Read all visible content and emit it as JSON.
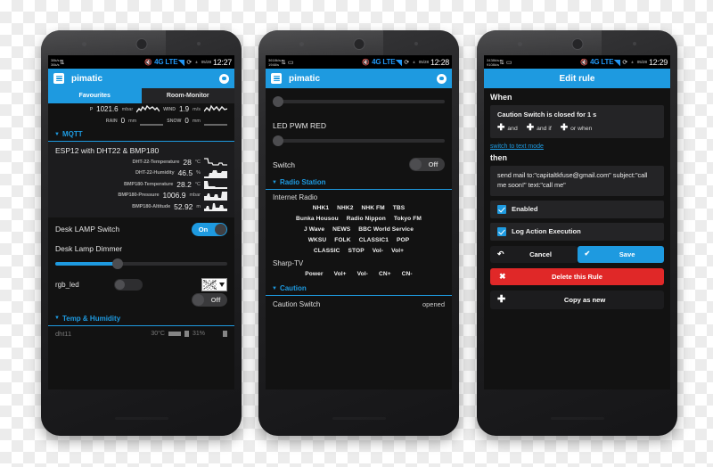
{
  "phones": [
    {
      "id": "phone-1",
      "statusbar": {
        "rate_up": "38k/s",
        "rate_down": "36k/s",
        "mute_icon": "volume-mute-icon",
        "network": "4G LTE",
        "sync_icon": "sync-icon",
        "alarm": "±",
        "date": "05/28",
        "time": "12:27"
      },
      "appbar": {
        "menu_icon": "hamburger-menu-icon",
        "title": "pimatic",
        "settings_icon": "gear-icon"
      },
      "tabs": [
        {
          "label": "Favourites",
          "active": true
        },
        {
          "label": "Room-Monitor",
          "active": false
        }
      ],
      "weather": [
        {
          "label": "P",
          "value": "1021.6",
          "unit": "mbar",
          "spark": true
        },
        {
          "label": "WIND",
          "value": "1.9",
          "unit": "m/s",
          "spark": true
        },
        {
          "label": "RAIN",
          "value": "0",
          "unit": "mm",
          "spark": true
        },
        {
          "label": "SNOW",
          "value": "0",
          "unit": "mm",
          "spark": true
        }
      ],
      "section": {
        "caret": "caret-down-icon",
        "title": "MQTT"
      },
      "card_title": "ESP12 with DHT22 & BMP180",
      "metrics": [
        {
          "label": "DHT-22-Temperature",
          "value": "28",
          "unit": "°C"
        },
        {
          "label": "DHT-22-Humidity",
          "value": "46.5",
          "unit": "%"
        },
        {
          "label": "BMP180-Temperature",
          "value": "28.2",
          "unit": "°C"
        },
        {
          "label": "BMP180-Pressure",
          "value": "1006.9",
          "unit": "mbar"
        },
        {
          "label": "BMP180-Altitude",
          "value": "52.92",
          "unit": "m"
        }
      ],
      "lamp_switch": {
        "label": "Desk LAMP Switch",
        "state": "On"
      },
      "dimmer": {
        "label": "Desk Lamp Dimmer",
        "percent": 36
      },
      "rgb": {
        "label": "rgb_led",
        "swatch_icon": "color-swatch-transparent-icon",
        "caret_icon": "caret-down-icon",
        "state": "Off"
      },
      "section2": {
        "caret": "caret-down-icon",
        "title": "Temp & Humidity"
      },
      "partial": {
        "key": "dht11",
        "temp": "30°C",
        "humidity": "31%"
      }
    },
    {
      "id": "phone-2",
      "statusbar": {
        "rate_up": "3618k/s",
        "rate_down": "1948/s",
        "mute_icon": "volume-mute-icon",
        "network": "4G LTE",
        "sync_icon": "sync-icon",
        "alarm": "±",
        "date": "05/28",
        "time": "12:28"
      },
      "appbar": {
        "menu_icon": "hamburger-menu-icon",
        "title": "pimatic",
        "settings_icon": "gear-icon"
      },
      "slider_top": {
        "percent": 0
      },
      "led_pwm": {
        "label": "LED PWM RED",
        "percent": 0
      },
      "switch": {
        "label": "Switch",
        "state": "Off"
      },
      "section": {
        "caret": "caret-down-icon",
        "title": "Radio Station"
      },
      "group_label": "Internet Radio",
      "radio_rows": [
        [
          "NHK1",
          "NHK2",
          "NHK FM",
          "TBS"
        ],
        [
          "Bunka Housou",
          "Radio Nippon",
          "Tokyo FM"
        ],
        [
          "J Wave",
          "NEWS",
          "BBC World Service"
        ],
        [
          "WKSU",
          "FOLK",
          "CLASSIC1",
          "POP"
        ],
        [
          "CLASSIC",
          "STOP",
          "Vol-",
          "Vol+"
        ]
      ],
      "group_label2": "Sharp-TV",
      "tv_row": [
        "Power",
        "Vol+",
        "Vol-",
        "CN+",
        "CN-"
      ],
      "section2": {
        "caret": "caret-down-icon",
        "title": "Caution"
      },
      "caution": {
        "key": "Caution Switch",
        "value": "opened"
      }
    },
    {
      "id": "phone-3",
      "statusbar": {
        "rate_up": "3438k/s",
        "rate_down": "9108k/s",
        "mute_icon": "volume-mute-icon",
        "network": "4G LTE",
        "sync_icon": "sync-icon",
        "alarm": "±",
        "date": "05/28",
        "time": "12:29"
      },
      "appbar": {
        "title": "Edit rule"
      },
      "when_heading": "When",
      "condition": "Caution Switch is closed for 1 s",
      "ops": [
        {
          "icon": "plus-icon",
          "label": "and"
        },
        {
          "icon": "plus-icon",
          "label": "and if"
        },
        {
          "icon": "plus-icon",
          "label": "or when"
        }
      ],
      "text_mode_link": "switch to text mode",
      "then_heading": "then",
      "action_text": "send mail to:\"capitaltkfuse@gmail.com\" subject:\"call me soon!\" text:\"call me\"",
      "checkboxes": [
        {
          "label": "Enabled",
          "checked": true
        },
        {
          "label": "Log Action Execution",
          "checked": true
        }
      ],
      "buttons": {
        "cancel": {
          "label": "Cancel",
          "icon": "undo-icon"
        },
        "save": {
          "label": "Save",
          "icon": "check-icon"
        },
        "delete": {
          "label": "Delete this Rule",
          "icon": "close-x-icon"
        },
        "copy": {
          "label": "Copy as new",
          "icon": "plus-icon"
        }
      }
    }
  ],
  "colors": {
    "accent": "#1e9ae0",
    "danger": "#e02828",
    "screen_bg": "#121212",
    "card_bg": "#1c1c1e"
  }
}
